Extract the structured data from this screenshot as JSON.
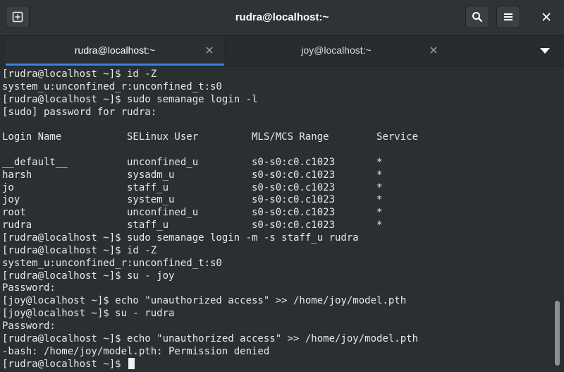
{
  "window": {
    "title": "rudra@localhost:~"
  },
  "header": {
    "new_tab_icon": "new-tab-icon",
    "search_icon": "search-icon",
    "menu_icon": "hamburger-menu-icon",
    "close_icon": "close-icon"
  },
  "tabs": [
    {
      "label": "rudra@localhost:~",
      "active": true
    },
    {
      "label": "joy@localhost:~",
      "active": false
    }
  ],
  "colors": {
    "accent": "#3583e4",
    "terminal_bg": "#2b2f31",
    "text": "#e6e8e9"
  },
  "terminal": {
    "lines": [
      "[rudra@localhost ~]$ id -Z",
      "system_u:unconfined_r:unconfined_t:s0",
      "[rudra@localhost ~]$ sudo semanage login -l",
      "[sudo] password for rudra:",
      "",
      "Login Name           SELinux User         MLS/MCS Range        Service",
      "",
      "__default__          unconfined_u         s0-s0:c0.c1023       *",
      "harsh                sysadm_u             s0-s0:c0.c1023       *",
      "jo                   staff_u              s0-s0:c0.c1023       *",
      "joy                  system_u             s0-s0:c0.c1023       *",
      "root                 unconfined_u         s0-s0:c0.c1023       *",
      "rudra                staff_u              s0-s0:c0.c1023       *",
      "[rudra@localhost ~]$ sudo semanage login -m -s staff_u rudra",
      "[rudra@localhost ~]$ id -Z",
      "system_u:unconfined_r:unconfined_t:s0",
      "[rudra@localhost ~]$ su - joy",
      "Password:",
      "[joy@localhost ~]$ echo \"unauthorized access\" >> /home/joy/model.pth",
      "[joy@localhost ~]$ su - rudra",
      "Password:",
      "[rudra@localhost ~]$ echo \"unauthorized access\" >> /home/joy/model.pth",
      "-bash: /home/joy/model.pth: Permission denied"
    ],
    "prompt": "[rudra@localhost ~]$ "
  }
}
